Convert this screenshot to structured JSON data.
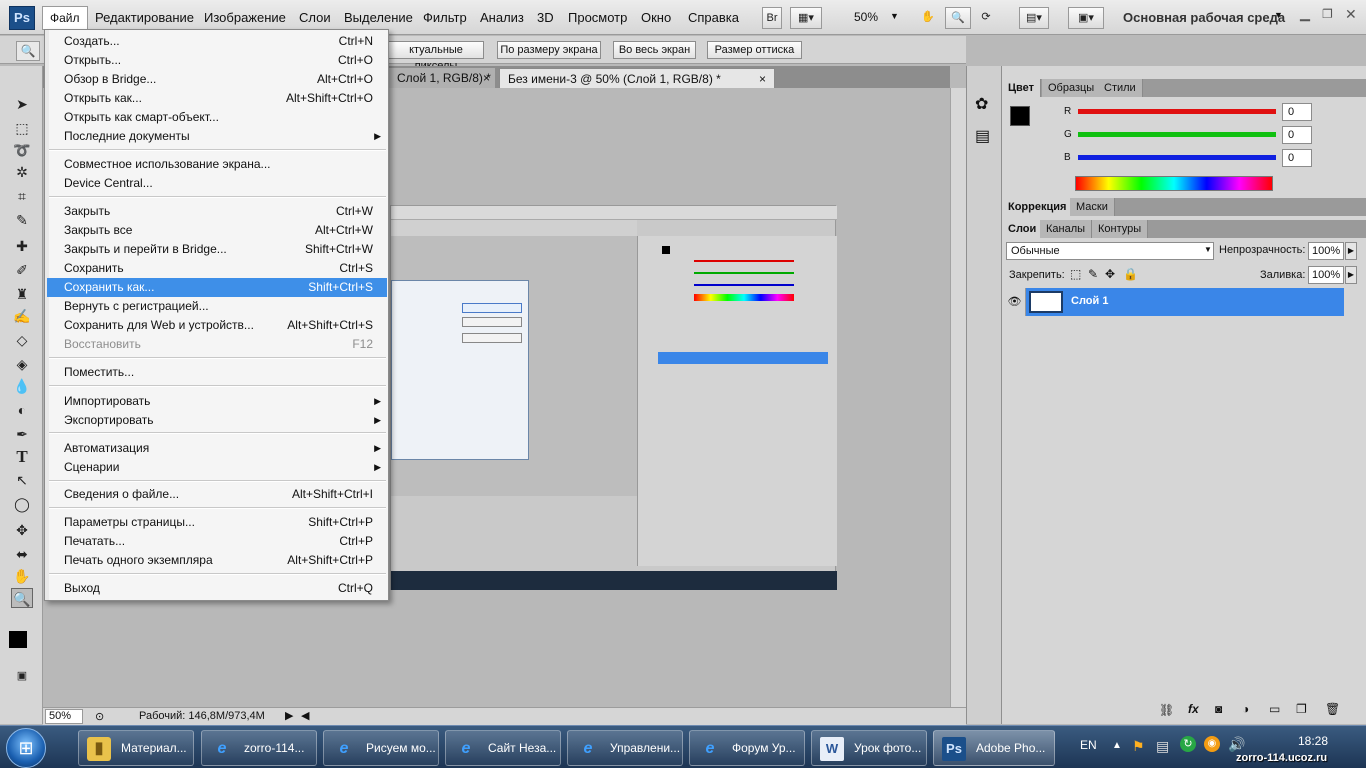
{
  "app": {
    "logo": "Ps"
  },
  "menubar": {
    "items": [
      "Файл",
      "Редактирование",
      "Изображение",
      "Слои",
      "Выделение",
      "Фильтр",
      "Анализ",
      "3D",
      "Просмотр",
      "Окно",
      "Справка"
    ],
    "bridge_btn": "Br",
    "zoom": "50%",
    "workspace": "Основная рабочая среда"
  },
  "options": {
    "buttons": [
      "ктуальные пикселы",
      "По размеру экрана",
      "Во весь экран",
      "Размер оттиска"
    ]
  },
  "tabs": [
    {
      "label": "Слой 1, RGB/8) *",
      "close": "×"
    },
    {
      "label": "Без имени-3 @ 50% (Слой 1, RGB/8) *",
      "close": "×"
    }
  ],
  "file_menu": {
    "items": [
      {
        "label": "Создать...",
        "shortcut": "Ctrl+N"
      },
      {
        "label": "Открыть...",
        "shortcut": "Ctrl+O"
      },
      {
        "label": "Обзор в Bridge...",
        "shortcut": "Alt+Ctrl+O"
      },
      {
        "label": "Открыть как...",
        "shortcut": "Alt+Shift+Ctrl+O"
      },
      {
        "label": "Открыть как смарт-объект...",
        "shortcut": ""
      },
      {
        "label": "Последние документы",
        "shortcut": "",
        "submenu": true
      },
      {
        "label": "Совместное использование экрана...",
        "shortcut": ""
      },
      {
        "label": "Device Central...",
        "shortcut": ""
      },
      {
        "label": "Закрыть",
        "shortcut": "Ctrl+W"
      },
      {
        "label": "Закрыть все",
        "shortcut": "Alt+Ctrl+W"
      },
      {
        "label": "Закрыть и перейти в Bridge...",
        "shortcut": "Shift+Ctrl+W"
      },
      {
        "label": "Сохранить",
        "shortcut": "Ctrl+S"
      },
      {
        "label": "Сохранить как...",
        "shortcut": "Shift+Ctrl+S",
        "selected": true
      },
      {
        "label": "Вернуть с регистрацией...",
        "shortcut": ""
      },
      {
        "label": "Сохранить для Web и устройств...",
        "shortcut": "Alt+Shift+Ctrl+S"
      },
      {
        "label": "Восстановить",
        "shortcut": "F12",
        "disabled": true
      },
      {
        "label": "Поместить...",
        "shortcut": ""
      },
      {
        "label": "Импортировать",
        "shortcut": "",
        "submenu": true
      },
      {
        "label": "Экспортировать",
        "shortcut": "",
        "submenu": true
      },
      {
        "label": "Автоматизация",
        "shortcut": "",
        "submenu": true
      },
      {
        "label": "Сценарии",
        "shortcut": "",
        "submenu": true
      },
      {
        "label": "Сведения о файле...",
        "shortcut": "Alt+Shift+Ctrl+I"
      },
      {
        "label": "Параметры страницы...",
        "shortcut": "Shift+Ctrl+P"
      },
      {
        "label": "Печатать...",
        "shortcut": "Ctrl+P"
      },
      {
        "label": "Печать одного экземпляра",
        "shortcut": "Alt+Shift+Ctrl+P"
      },
      {
        "label": "Выход",
        "shortcut": "Ctrl+Q"
      }
    ]
  },
  "color_panel": {
    "tabs": [
      "Цвет",
      "Образцы",
      "Стили"
    ],
    "channels": [
      {
        "name": "R",
        "value": "0",
        "color": "#e01010"
      },
      {
        "name": "G",
        "value": "0",
        "color": "#10c010"
      },
      {
        "name": "B",
        "value": "0",
        "color": "#1020e0"
      }
    ]
  },
  "adjust_panel": {
    "tabs": [
      "Коррекция",
      "Маски"
    ]
  },
  "layers_panel": {
    "tabs": [
      "Слои",
      "Каналы",
      "Контуры"
    ],
    "blend_mode": "Обычные",
    "opacity_label": "Непрозрачность:",
    "opacity": "100%",
    "lock_label": "Закрепить:",
    "fill_label": "Заливка:",
    "fill": "100%",
    "layer_name": "Слой 1",
    "footer_fx": "fx"
  },
  "status": {
    "zoom": "50%",
    "info": "Рабочий: 146,8M/973,4M"
  },
  "taskbar": {
    "items": [
      "Материал...",
      "zorro-114...",
      "Рисуем мо...",
      "Сайт Незa...",
      "Управлени...",
      "Форум Ур...",
      "Урок фото...",
      "Adobe Pho..."
    ],
    "lang": "EN",
    "time": "18:28",
    "watermark": "zorro-114.ucoz.ru"
  },
  "colors": {
    "accent": "#3e8fe8",
    "selection": "#3a86e8",
    "taskbar": "#1d3554"
  }
}
